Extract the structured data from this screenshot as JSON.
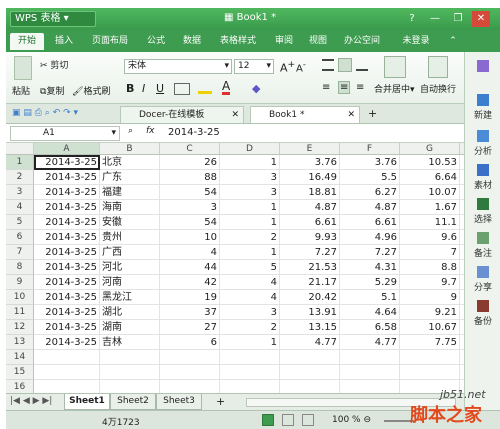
{
  "app_button": "WPS 表格",
  "doc_title": "Book1 *",
  "window_controls": [
    "?",
    "—",
    "❐",
    "✕"
  ],
  "menu_tabs": [
    "开始",
    "插入",
    "页面布局",
    "公式",
    "数据",
    "表格样式",
    "审阅",
    "视图",
    "办公空间",
    "未登录"
  ],
  "ribbon": {
    "cut": "剪切",
    "paste": "粘贴",
    "copy": "复制",
    "format_painter": "格式刷",
    "font_name": "宋体",
    "font_size": "12",
    "merge_center": "合并居中",
    "auto_wrap": "自动换行"
  },
  "doc_tabs": [
    "Docer-在线模板",
    "Book1 *"
  ],
  "name_box": "A1",
  "fx_label": "fx",
  "formula_value": "2014-3-25",
  "columns": [
    "A",
    "B",
    "C",
    "D",
    "E",
    "F",
    "G",
    "H"
  ],
  "rows": [
    [
      "2014-3-25",
      "北京",
      "26",
      "1",
      "3.76",
      "3.76",
      "10.53"
    ],
    [
      "2014-3-25",
      "广东",
      "88",
      "3",
      "16.49",
      "5.5",
      "6.64"
    ],
    [
      "2014-3-25",
      "福建",
      "54",
      "3",
      "18.81",
      "6.27",
      "10.07"
    ],
    [
      "2014-3-25",
      "海南",
      "3",
      "1",
      "4.87",
      "4.87",
      "1.67"
    ],
    [
      "2014-3-25",
      "安徽",
      "54",
      "1",
      "6.61",
      "6.61",
      "11.1"
    ],
    [
      "2014-3-25",
      "贵州",
      "10",
      "2",
      "9.93",
      "4.96",
      "9.6"
    ],
    [
      "2014-3-25",
      "广西",
      "4",
      "1",
      "7.27",
      "7.27",
      "7"
    ],
    [
      "2014-3-25",
      "河北",
      "44",
      "5",
      "21.53",
      "4.31",
      "8.8"
    ],
    [
      "2014-3-25",
      "河南",
      "42",
      "4",
      "21.17",
      "5.29",
      "9.7"
    ],
    [
      "2014-3-25",
      "黑龙江",
      "19",
      "4",
      "20.42",
      "5.1",
      "9"
    ],
    [
      "2014-3-25",
      "湖北",
      "37",
      "3",
      "13.91",
      "4.64",
      "9.21"
    ],
    [
      "2014-3-25",
      "湖南",
      "27",
      "2",
      "13.15",
      "6.58",
      "10.67"
    ],
    [
      "2014-3-25",
      "吉林",
      "6",
      "1",
      "4.77",
      "4.77",
      "7.75"
    ]
  ],
  "row_numbers": [
    "1",
    "2",
    "3",
    "4",
    "5",
    "6",
    "7",
    "8",
    "9",
    "10",
    "11",
    "12",
    "13",
    "14",
    "15",
    "16",
    "17",
    "18"
  ],
  "sheets": [
    "Sheet1",
    "Sheet2",
    "Sheet3"
  ],
  "sheet_add": "+",
  "status_text": "4万1723",
  "zoom": "100 %",
  "side_panel": [
    "新建",
    "分析",
    "素材",
    "选择",
    "备注",
    "分享",
    "备份"
  ],
  "watermark": {
    "site": "jb51.net",
    "brand": "脚本之家"
  }
}
